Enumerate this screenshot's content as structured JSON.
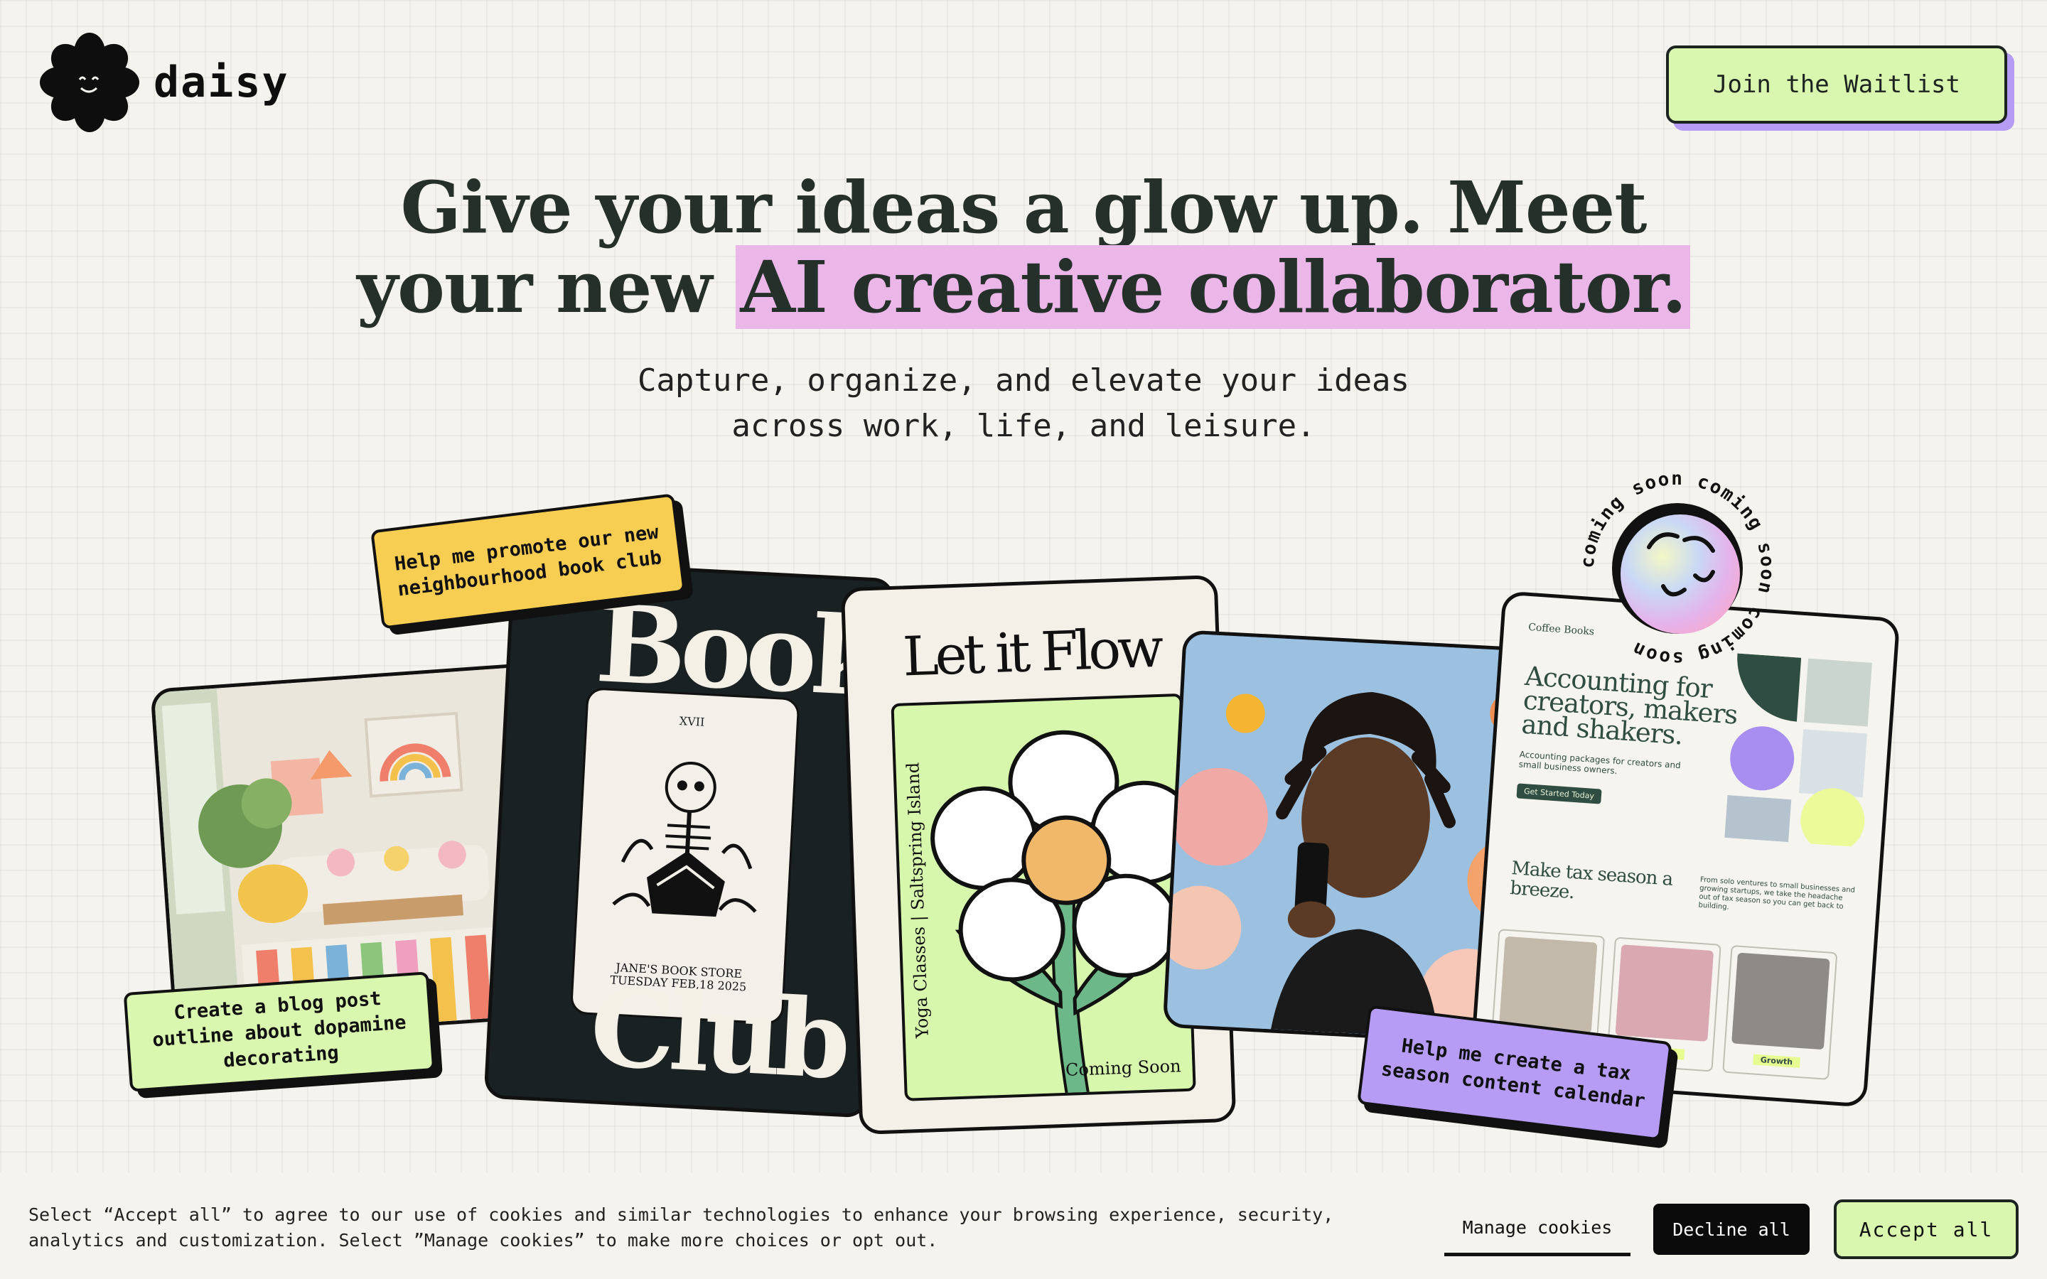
{
  "brand": {
    "name": "daisy"
  },
  "header": {
    "waitlist_label": "Join the Waitlist"
  },
  "hero": {
    "headline_line1": "Give your ideas a glow up. Meet",
    "headline_line2_plain": "your new ",
    "headline_line2_highlight": "AI creative collaborator.",
    "subhead_line1": "Capture, organize, and elevate your ideas",
    "subhead_line2": "across work, life, and leisure."
  },
  "cards": {
    "book_club": {
      "word1": "Book",
      "word2": "Club",
      "tarot_number": "XVII",
      "caption_line1": "JANE'S BOOK STORE",
      "caption_line2": "TUESDAY FEB,18 2025"
    },
    "flow": {
      "title": "Let it Flow",
      "side_text": "Yoga Classes | Saltspring Island",
      "footer": "Coming Soon"
    },
    "website": {
      "brand": "Coffee Books",
      "headline": "Accounting for creators, makers and shakers.",
      "tagline": "Accounting packages for creators and small business owners.",
      "cta": "Get Started Today",
      "subheading": "Make tax season a breeze.",
      "body": "From solo ventures to small businesses and growing startups, we take the headache out of tax season so you can get back to building.",
      "tiles": [
        {
          "label": ""
        },
        {
          "label": "Startup"
        },
        {
          "label": "Growth"
        }
      ]
    }
  },
  "badge": {
    "ring_text": "coming soon coming soon coming soon "
  },
  "prompts": {
    "promote": "Help me promote our new neighbourhood book club",
    "blog": "Create a blog post outline about dopamine decorating",
    "tax": "Help me create a tax season content calendar"
  },
  "cookie": {
    "text": "Select “Accept all” to agree to our use of cookies and similar technologies to enhance your browsing experience, security, analytics and customization. Select ”Manage cookies” to make more choices or opt out.",
    "manage_label": "Manage cookies",
    "decline_label": "Decline all",
    "accept_label": "Accept all"
  },
  "colors": {
    "background": "#f5f3ee",
    "accent_green": "#d9f7ae",
    "accent_purple": "#b79cf5",
    "accent_yellow": "#f7cd52",
    "highlight_pink": "#eab7e8"
  }
}
